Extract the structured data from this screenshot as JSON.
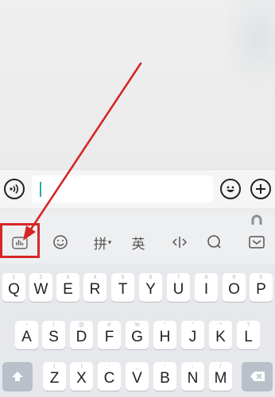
{
  "toolbar": {
    "pinyin_label": "拼",
    "pinyin_dropdown": "▾",
    "english_label": "英"
  },
  "keyboard": {
    "row1": [
      {
        "hint": "1",
        "key": "Q"
      },
      {
        "hint": "2",
        "key": "W"
      },
      {
        "hint": "3",
        "key": "E"
      },
      {
        "hint": "4",
        "key": "R"
      },
      {
        "hint": "5",
        "key": "T"
      },
      {
        "hint": "6",
        "key": "Y"
      },
      {
        "hint": "7",
        "key": "U"
      },
      {
        "hint": "8",
        "key": "I"
      },
      {
        "hint": "9",
        "key": "O"
      },
      {
        "hint": "0",
        "key": "P"
      }
    ],
    "row2": [
      {
        "hint": "~",
        "key": "A"
      },
      {
        "hint": "!",
        "key": "S"
      },
      {
        "hint": "@",
        "key": "D"
      },
      {
        "hint": "#",
        "key": "F"
      },
      {
        "hint": "%",
        "key": "G"
      },
      {
        "hint": "“",
        "key": "H"
      },
      {
        "hint": "”",
        "key": "J"
      },
      {
        "hint": "*",
        "key": "K"
      },
      {
        "hint": "?",
        "key": "L"
      }
    ],
    "row3": [
      {
        "hint": "(",
        "key": "Z"
      },
      {
        "hint": ")",
        "key": "X"
      },
      {
        "hint": "-",
        "key": "C"
      },
      {
        "hint": "_",
        "key": "V"
      },
      {
        "hint": ":",
        "key": "B"
      },
      {
        "hint": ";",
        "key": "N"
      },
      {
        "hint": "/",
        "key": "M"
      }
    ]
  },
  "colors": {
    "annotation_red": "#d62626",
    "caret_teal": "#27b0a0"
  }
}
